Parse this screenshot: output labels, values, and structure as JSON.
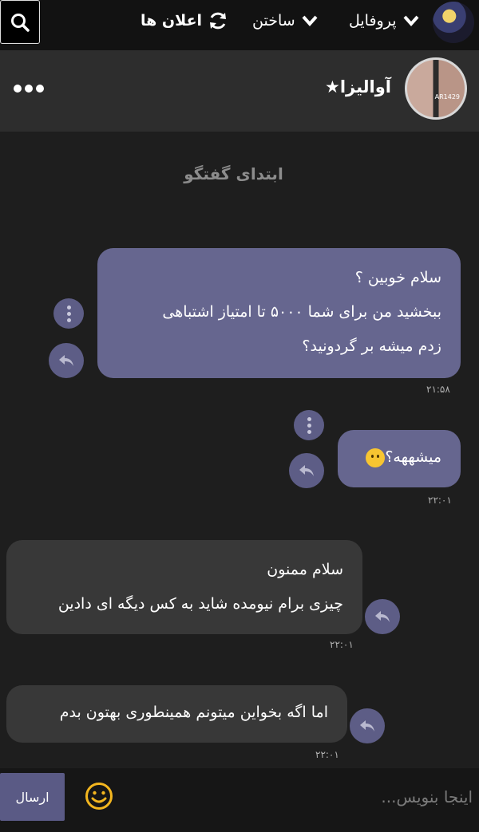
{
  "nav": {
    "profile_label": "پروفایل",
    "create_label": "ساختن",
    "notifications_label": "اعلان ها"
  },
  "chat": {
    "title": "آوالیزا★",
    "avatar_tag": "AR1429",
    "conversation_start": "ابتدای گفتگو"
  },
  "messages": [
    {
      "sender": "me",
      "lines": [
        "سلام خوبین ؟",
        "ببخشید من برای شما ۵۰۰۰ تا امتیاز اشتباهی",
        "زدم میشه بر گردونید؟"
      ],
      "time": "۲۱:۵۸"
    },
    {
      "sender": "me",
      "lines": [
        "میشههه؟"
      ],
      "emoji": "hugging-face-emoji",
      "time": "۲۲:۰۱"
    },
    {
      "sender": "them",
      "lines": [
        "سلام ممنون",
        "چیزی برام نیومده شاید به کس دیگه ای دادین"
      ],
      "time": "۲۲:۰۱"
    },
    {
      "sender": "them",
      "lines": [
        "اما اگه بخواین میتونم همینطوری بهتون بدم"
      ],
      "time": "۲۲:۰۱"
    }
  ],
  "composer": {
    "placeholder": "اینجا بنویس...",
    "send_label": "ارسال"
  },
  "colors": {
    "background": "#1e1e1e",
    "topbar": "#121212",
    "header": "#2d2d2d",
    "my_bubble": "#66668f",
    "their_bubble": "#383838",
    "accent": "#5a5a85",
    "emoji_button": "#f3b61f"
  },
  "icons": [
    "search-icon",
    "refresh-icon",
    "chevron-down-icon",
    "more-icon",
    "kebab-icon",
    "reply-icon",
    "emoji-icon"
  ]
}
